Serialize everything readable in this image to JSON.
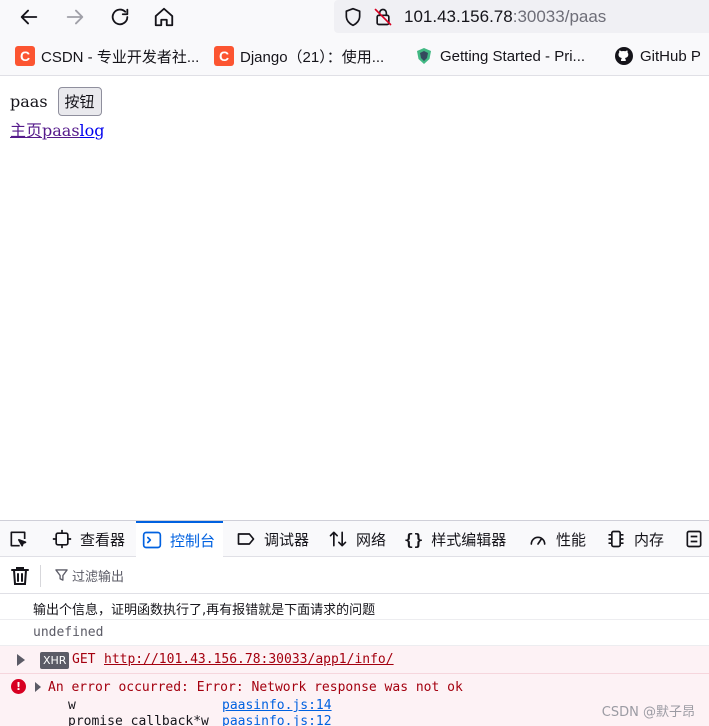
{
  "browser": {
    "url_host": "101.43.156.78",
    "url_rest": ":30033/paas"
  },
  "bookmarks": [
    {
      "label": "CSDN - 专业开发者社...",
      "icon": "csdn-icon"
    },
    {
      "label": "Django（21）：使用...",
      "icon": "django-icon"
    },
    {
      "label": "Getting Started - Pri...",
      "icon": "primevue-icon"
    },
    {
      "label": "GitHub P",
      "icon": "github-icon"
    }
  ],
  "page": {
    "text": "paas",
    "button_label": "按钮",
    "link_home": "主页paas",
    "link_log": "log"
  },
  "devtools": {
    "tabs": [
      {
        "label": "查看器",
        "icon": "inspector-icon"
      },
      {
        "label": "控制台",
        "icon": "console-icon",
        "active": true
      },
      {
        "label": "调试器",
        "icon": "debugger-icon"
      },
      {
        "label": "网络",
        "icon": "network-icon"
      },
      {
        "label": "样式编辑器",
        "icon": "style-editor-icon"
      },
      {
        "label": "性能",
        "icon": "performance-icon"
      },
      {
        "label": "内存",
        "icon": "memory-icon"
      }
    ],
    "filter_placeholder": "过滤输出",
    "console": {
      "log1": "输出个信息，证明函数执行了,再有报错就是下面请求的问题",
      "log2": "undefined",
      "xhr_badge": "XHR",
      "xhr_method": "GET",
      "xhr_url": "http://101.43.156.78:30033/app1/info/",
      "error_message": "An error occurred: Error: Network response was not ok",
      "stack": [
        {
          "fn": "w",
          "src": "paasinfo.js:14"
        },
        {
          "fn": "promise callback*w",
          "src": "paasinfo.js:12"
        }
      ]
    }
  },
  "watermark": "CSDN @默子昂",
  "colors": {
    "accent": "#0061e0",
    "error_text": "#a4000f",
    "error_bg": "#fdf2f5"
  }
}
